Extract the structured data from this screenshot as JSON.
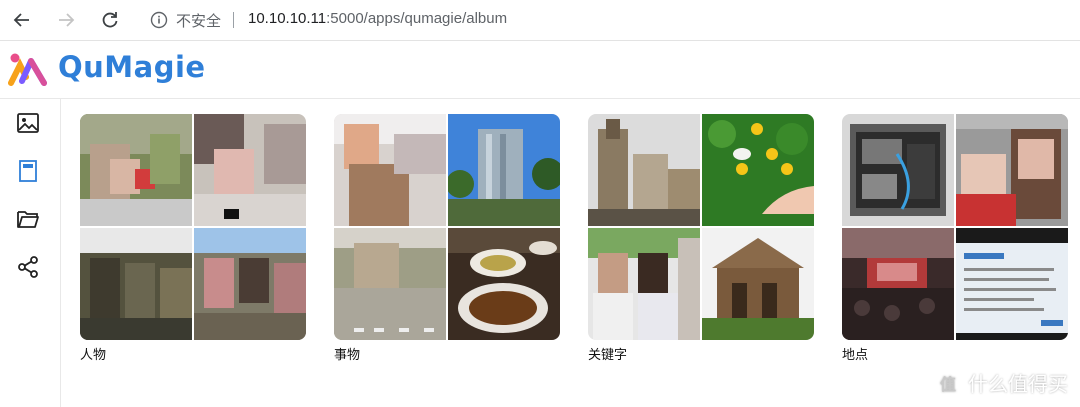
{
  "browser": {
    "security_label": "不安全",
    "url_host": "10.10.10.11",
    "url_rest": ":5000/apps/qumagie/album"
  },
  "app": {
    "name": "QuMagie"
  },
  "sidebar": {
    "items": [
      {
        "icon": "image-icon",
        "label": "Photos"
      },
      {
        "icon": "album-icon",
        "label": "Album"
      },
      {
        "icon": "folder-icon",
        "label": "Folders"
      },
      {
        "icon": "share-icon",
        "label": "Share"
      }
    ],
    "active_color": "#2f7fd8"
  },
  "albums": [
    {
      "label": "人物"
    },
    {
      "label": "事物"
    },
    {
      "label": "关键字"
    },
    {
      "label": "地点"
    }
  ],
  "watermark": {
    "text": "什么值得买",
    "badge": "值"
  }
}
